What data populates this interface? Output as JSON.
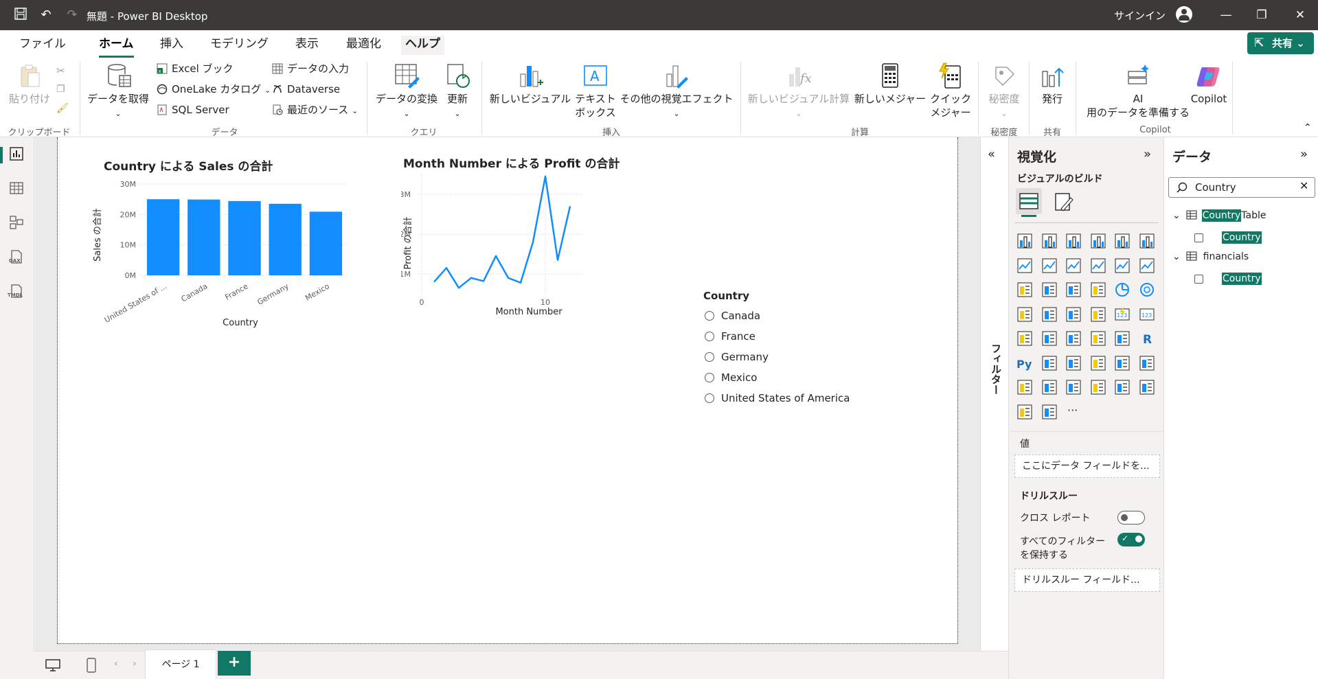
{
  "window": {
    "title": "無題 - Power BI Desktop",
    "signin_label": "サインイン"
  },
  "menu": {
    "tabs": [
      "ファイル",
      "ホーム",
      "挿入",
      "モデリング",
      "表示",
      "最適化",
      "ヘルプ"
    ],
    "active": "ホーム",
    "share_label": "共有"
  },
  "ribbon": {
    "clipboard": {
      "paste": "貼り付け",
      "group": "クリップボード"
    },
    "data": {
      "get_data": "データを取得",
      "excel": "Excel ブック",
      "onelake": "OneLake カタログ",
      "sql": "SQL Server",
      "enter_data": "データの入力",
      "dataverse": "Dataverse",
      "recent": "最近のソース",
      "group": "データ"
    },
    "query": {
      "transform": "データの変換",
      "refresh": "更新",
      "group": "クエリ"
    },
    "insert": {
      "new_visual": "新しいビジュアル",
      "textbox_1": "テキスト",
      "textbox_2": "ボックス",
      "more_visuals": "その他の視覚エフェクト",
      "group": "挿入"
    },
    "calc": {
      "new_visual_calc": "新しいビジュアル計算",
      "new_measure": "新しいメジャー",
      "quick_measure_1": "クイック",
      "quick_measure_2": "メジャー",
      "group": "計算"
    },
    "sensitivity": {
      "label": "秘密度",
      "group": "秘密度"
    },
    "share": {
      "publish": "発行",
      "group": "共有"
    },
    "copilot": {
      "ai_1": "AI",
      "ai_2": "用のデータを準備する",
      "copilot": "Copilot",
      "group": "Copilot"
    }
  },
  "leftnav": {
    "items": [
      "report-view",
      "table-view",
      "model-view",
      "dax-query-view",
      "tmdl-view"
    ],
    "dax_label": "DAX",
    "tmdl_label": "TMDL"
  },
  "visuals": {
    "bar": {
      "title": "Country による Sales の合計",
      "xlabel": "Country",
      "ylabel": "Sales の合計"
    },
    "line": {
      "title": "Month Number による Profit の合計",
      "xlabel": "Month Number",
      "ylabel": "Profit の合計"
    },
    "slicer": {
      "title": "Country",
      "items": [
        "Canada",
        "France",
        "Germany",
        "Mexico",
        "United States of America"
      ]
    }
  },
  "chart_data": [
    {
      "type": "bar",
      "title": "Country による Sales の合計",
      "xlabel": "Country",
      "ylabel": "Sales の合計",
      "categories": [
        "United States of ...",
        "Canada",
        "France",
        "Germany",
        "Mexico"
      ],
      "values": [
        25,
        24.9,
        24.4,
        23.5,
        20.9
      ],
      "unit": "M",
      "ylim": [
        0,
        30
      ],
      "yticks": [
        "0M",
        "10M",
        "20M",
        "30M"
      ],
      "color": "#118dff",
      "grid": true
    },
    {
      "type": "line",
      "title": "Month Number による Profit の合計",
      "xlabel": "Month Number",
      "ylabel": "Profit の合計",
      "x": [
        1,
        2,
        3,
        4,
        5,
        6,
        7,
        8,
        9,
        10,
        11,
        12
      ],
      "y": [
        0.8,
        1.15,
        0.65,
        0.9,
        0.82,
        1.45,
        0.9,
        0.78,
        1.8,
        3.45,
        1.35,
        2.7
      ],
      "unit": "M",
      "xlim": [
        0,
        13
      ],
      "ylim": [
        0.5,
        3.5
      ],
      "xticks": [
        "0",
        "10"
      ],
      "yticks": [
        "1M",
        "2M",
        "3M"
      ],
      "color": "#118dff",
      "grid": true
    }
  ],
  "filters_label": "フィルター",
  "viz_pane": {
    "title": "視覚化",
    "build_label": "ビジュアルのビルド",
    "values_label": "値",
    "values_placeholder": "ここにデータ フィールドを...",
    "drill_label": "ドリルスルー",
    "cross_report": "クロス レポート",
    "cross_report_state": "オフ",
    "keep_filters_1": "すべてのフィルター",
    "keep_filters_2": "を保持する",
    "keep_filters_state": "オン",
    "drill_placeholder": "ドリルスルー フィールド...",
    "more": "···"
  },
  "data_pane": {
    "title": "データ",
    "search_value": "Country",
    "tables": [
      {
        "name_hl": "Country",
        "name_rest": "Table",
        "field": "Country"
      },
      {
        "name_hl": "",
        "name_rest": "financials",
        "field": "Country"
      }
    ]
  },
  "bottom": {
    "page_label": "ページ 1",
    "add_label": "+"
  },
  "colors": {
    "accent": "#117865",
    "chart": "#118dff",
    "titlebar": "#3b3a39"
  }
}
